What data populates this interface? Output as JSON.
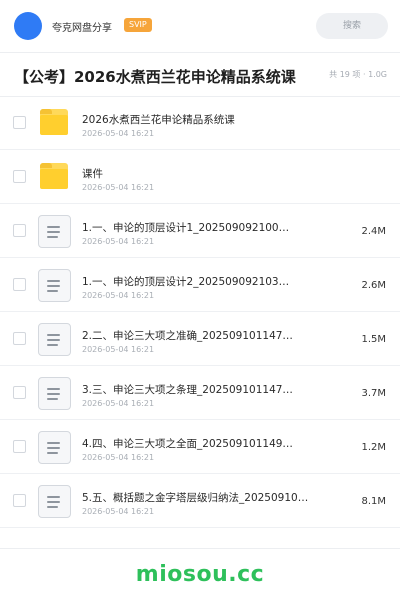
{
  "header": {
    "share_name": "夸克网盘分享",
    "badge": "SVIP",
    "search_placeholder": "搜索"
  },
  "title": "【公考】2026水煮西兰花申论精品系统课",
  "meta": "共 19 项 · 1.0G",
  "files": [
    {
      "type": "folder",
      "name": "2026水煮西兰花申论精品系统课",
      "date": "2026-05-04 16:21",
      "size": ""
    },
    {
      "type": "folder",
      "name": "课件",
      "date": "2026-05-04 16:21",
      "size": ""
    },
    {
      "type": "file",
      "name": "1.一、申论的顶层设计1_202509092100…",
      "date": "2026-05-04 16:21",
      "size": "2.4M"
    },
    {
      "type": "file",
      "name": "1.一、申论的顶层设计2_202509092103…",
      "date": "2026-05-04 16:21",
      "size": "2.6M"
    },
    {
      "type": "file",
      "name": "2.二、申论三大项之准确_202509101147…",
      "date": "2026-05-04 16:21",
      "size": "1.5M"
    },
    {
      "type": "file",
      "name": "3.三、申论三大项之条理_202509101147…",
      "date": "2026-05-04 16:21",
      "size": "3.7M"
    },
    {
      "type": "file",
      "name": "4.四、申论三大项之全面_202509101149…",
      "date": "2026-05-04 16:21",
      "size": "1.2M"
    },
    {
      "type": "file",
      "name": "5.五、概括题之金字塔层级归纳法_20250910…",
      "date": "2026-05-04 16:21",
      "size": "8.1M"
    }
  ],
  "watermark": "miosou.cc",
  "colors": {
    "accent": "#2f7bf5",
    "badge": "#f6a53a",
    "folder": "#ffcf2e",
    "watermark": "#2ec05b"
  }
}
